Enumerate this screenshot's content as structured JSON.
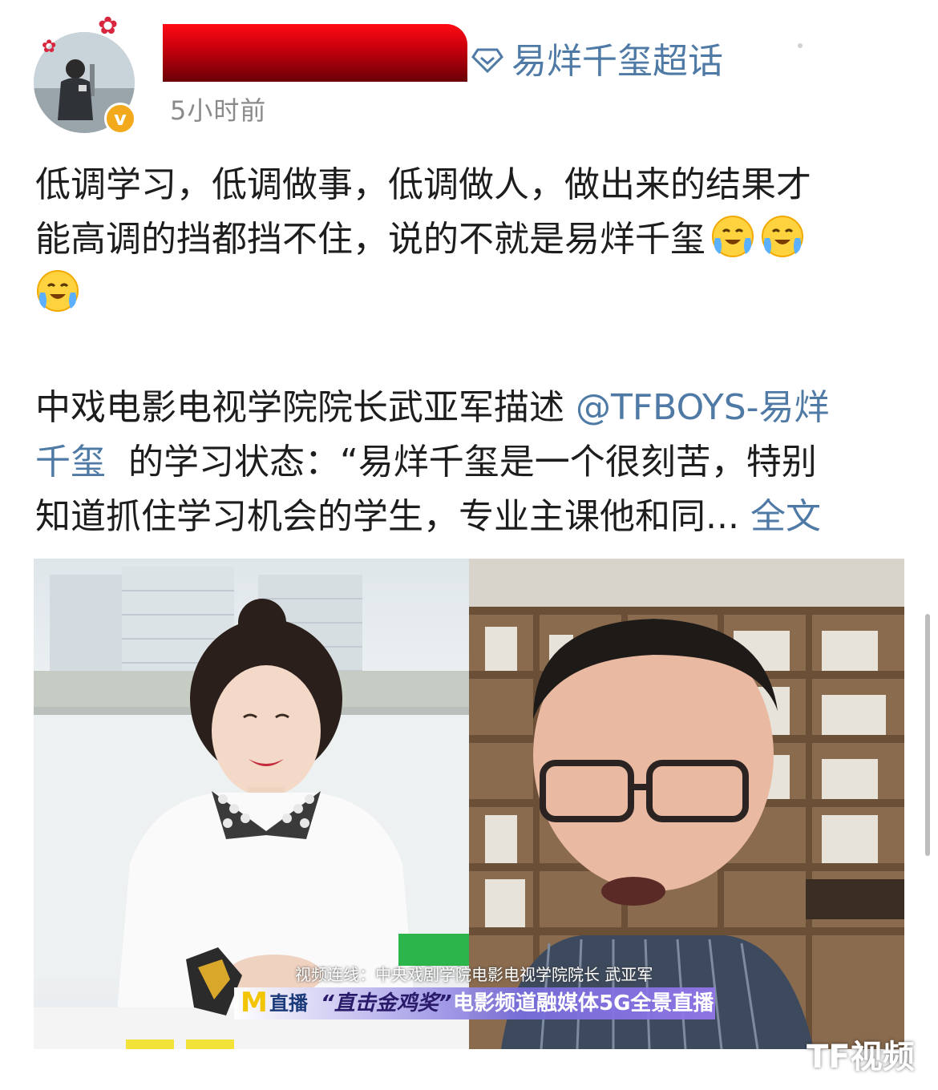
{
  "post": {
    "topic_label": "易烊千玺超话",
    "time": "5小时前",
    "verified_badge": "v",
    "paragraph1": {
      "line1": "低调学习，低调做事，低调做人，做出来的结果才",
      "line2": "能高调的挡都挡不住，说的不就是易烊千玺"
    },
    "paragraph2": {
      "line1_text": "中戏电影电视学院院长武亚军描述 ",
      "mention_part1": "@TFBOYS-易烊",
      "mention_part2": "千玺",
      "line2_text": "  的学习状态：“易烊千玺是一个很刻苦，特别",
      "line3_text": "知道抓住学习机会的学生，专业主课他和同... ",
      "expand_link": "全文"
    }
  },
  "video_frame": {
    "caption_small": "视频连线：中央戏剧学院电影电视学院院长 武亚军",
    "logo_m": "M",
    "live_label": "直播",
    "quote": "“直击金鸡奖”",
    "banner_text": "电影频道融媒体5G全景直播"
  },
  "watermark": "TF视频",
  "colors": {
    "link": "#4f7aa6",
    "text": "#1d1d1d",
    "meta": "#8a8a8a",
    "redaction": "#c2000c"
  },
  "icons": [
    "flower-decoration-icon",
    "verified-v-badge-icon",
    "diamond-topic-icon",
    "crying-laughing-emoji-icon"
  ]
}
